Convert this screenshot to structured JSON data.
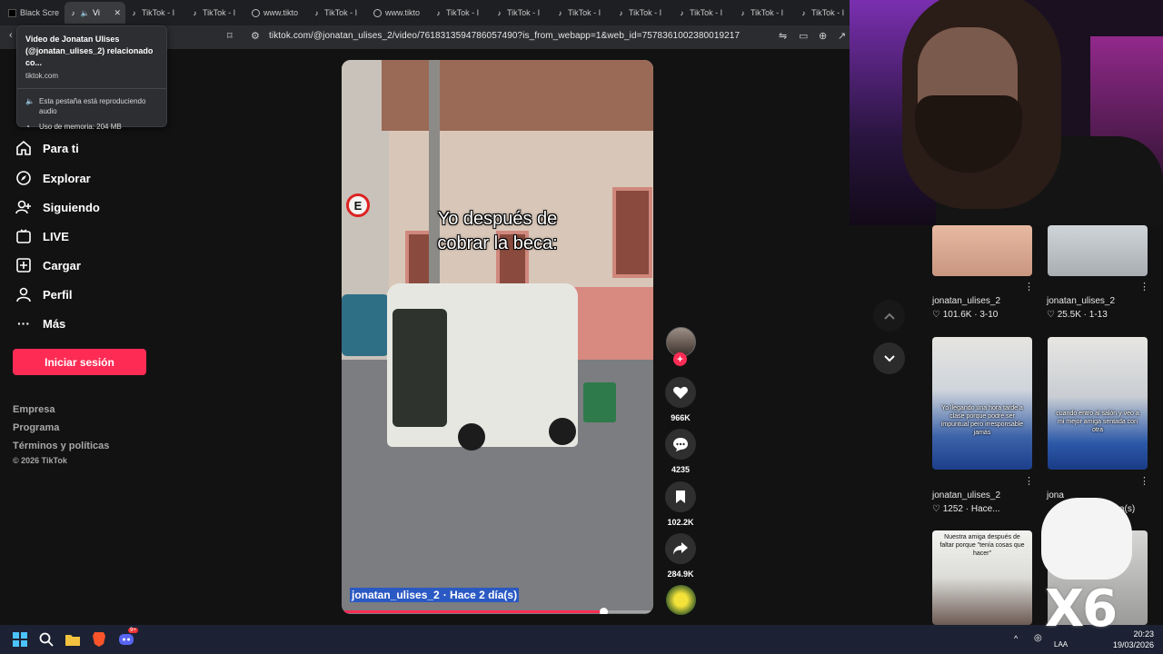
{
  "browser": {
    "tabs": [
      {
        "label": "Black Scre",
        "favicon": "black-square",
        "active": false
      },
      {
        "label": "Vi",
        "favicon": "tiktok",
        "active": true,
        "audio": true,
        "close": "✕"
      },
      {
        "label": "TikTok - I",
        "favicon": "tiktok",
        "active": false
      },
      {
        "label": "TikTok - I",
        "favicon": "tiktok",
        "active": false
      },
      {
        "label": "www.tikto",
        "favicon": "globe",
        "active": false
      },
      {
        "label": "TikTok - I",
        "favicon": "tiktok",
        "active": false
      },
      {
        "label": "www.tikto",
        "favicon": "globe",
        "active": false
      },
      {
        "label": "TikTok - I",
        "favicon": "tiktok",
        "active": false
      },
      {
        "label": "TikTok - I",
        "favicon": "tiktok",
        "active": false
      },
      {
        "label": "TikTok - I",
        "favicon": "tiktok",
        "active": false
      },
      {
        "label": "TikTok - I",
        "favicon": "tiktok",
        "active": false
      },
      {
        "label": "TikTok - I",
        "favicon": "tiktok",
        "active": false
      },
      {
        "label": "TikTok - I",
        "favicon": "tiktok",
        "active": false
      },
      {
        "label": "TikTok - I",
        "favicon": "tiktok",
        "active": false
      }
    ],
    "url": "tiktok.com/@jonatan_ulises_2/video/7618313594786057490?is_from_webapp=1&web_id=7578361002380019217",
    "hover_card": {
      "title": "Video de Jonatan Ulises (@jonatan_ulises_2) relacionado co...",
      "domain": "tiktok.com",
      "audio_text": "Esta pestaña está reproduciendo audio",
      "memory_text": "Uso de memoria: 204 MB"
    }
  },
  "sidebar": {
    "items": [
      {
        "label": "Para ti",
        "icon": "home-icon"
      },
      {
        "label": "Explorar",
        "icon": "compass-icon"
      },
      {
        "label": "Siguiendo",
        "icon": "user-follow-icon"
      },
      {
        "label": "LIVE",
        "icon": "live-icon"
      },
      {
        "label": "Cargar",
        "icon": "upload-icon"
      },
      {
        "label": "Perfil",
        "icon": "profile-icon"
      },
      {
        "label": "Más",
        "icon": "more-icon"
      }
    ],
    "login_label": "Iniciar sesión",
    "footer": [
      "Empresa",
      "Programa",
      "Términos y políticas"
    ],
    "copyright": "© 2026 TikTok"
  },
  "video": {
    "caption_line1": "Yo después de",
    "caption_line2": "cobrar la beca:",
    "author": "jonatan_ulises_2",
    "date": "· Hace 2 día(s)",
    "progress": 0.84
  },
  "actions": {
    "likes": "966K",
    "comments": "4235",
    "saves": "102.2K",
    "shares": "284.9K"
  },
  "grid": [
    {
      "author": "jonatan_ulises_2",
      "meta": "♡ 101.6K · 3-10",
      "text": ""
    },
    {
      "author": "jonatan_ulises_2",
      "meta": "♡ 25.5K · 1-13",
      "text": ""
    },
    {
      "author": "jonatan_ulises_2",
      "meta": "♡ 1252 · Hace...",
      "text": "Yo llegando una hora tarde a clase porque podré ser impuntual pero irresponsable jamás"
    },
    {
      "author": "jona",
      "meta": "a(s)",
      "text": "cuando entro al salón y veo a mi mejor amiga sentada con otra"
    },
    {
      "author": "",
      "meta": "",
      "text": "Nuestra amiga después de faltar porque \"tenía cosas que hacer\""
    }
  ],
  "overlay": {
    "label": "X6"
  },
  "taskbar": {
    "time": "20:23",
    "date": "19/03/2026",
    "lang": "LAA",
    "badge": "9+"
  },
  "colors": {
    "accent": "#fe2c55",
    "page_bg": "#121212",
    "selection": "#2b59c3"
  }
}
